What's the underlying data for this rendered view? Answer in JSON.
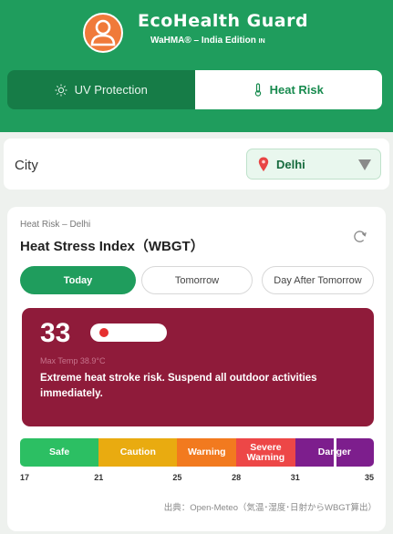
{
  "app": {
    "title": "EcoHealth Guard",
    "subtitle": "WaHMA® – India Edition",
    "subtitle_flag": "IN"
  },
  "tabs": [
    {
      "label": "UV Protection",
      "icon": "sun-icon",
      "active": false
    },
    {
      "label": "Heat Risk",
      "icon": "thermometer-icon",
      "active": true
    }
  ],
  "city": {
    "label": "City",
    "selected": "Delhi",
    "icon": "location-pin-icon"
  },
  "heat_card": {
    "eyebrow": "Heat Risk – Delhi",
    "title": "Heat Stress Index（WBGT）",
    "refresh_icon": "refresh-icon",
    "days": [
      "Today",
      "Tomorrow",
      "Day After Tomorrow"
    ],
    "active_day": 0,
    "wbgt": "33",
    "max_temp": "Max Temp 38.9°C",
    "message": "Extreme heat stroke risk. Suspend all outdoor activities immediately.",
    "scale": {
      "segments": [
        {
          "label": "Safe",
          "from": 17,
          "to": 21,
          "color": "#2cbf63"
        },
        {
          "label": "Caution",
          "from": 21,
          "to": 25,
          "color": "#e9ab10"
        },
        {
          "label": "Warning",
          "from": 25,
          "to": 28,
          "color": "#f27a1f"
        },
        {
          "label": "Severe Warning",
          "from": 28,
          "to": 31,
          "color": "#ed4747"
        },
        {
          "label": "Danger",
          "from": 31,
          "to": 35,
          "color": "#7d1e8d"
        }
      ],
      "ticks": [
        "17",
        "21",
        "25",
        "28",
        "31",
        "35"
      ],
      "min": 17,
      "max": 35,
      "current": 33
    },
    "source": "出典：Open-Meteo（気温･湿度･日射からWBGT算出）"
  },
  "colors": {
    "brand_green": "#1f9d5d",
    "dark_green": "#167c47",
    "alert_bg": "#8f1b3a",
    "avatar": "#f07a3a"
  }
}
